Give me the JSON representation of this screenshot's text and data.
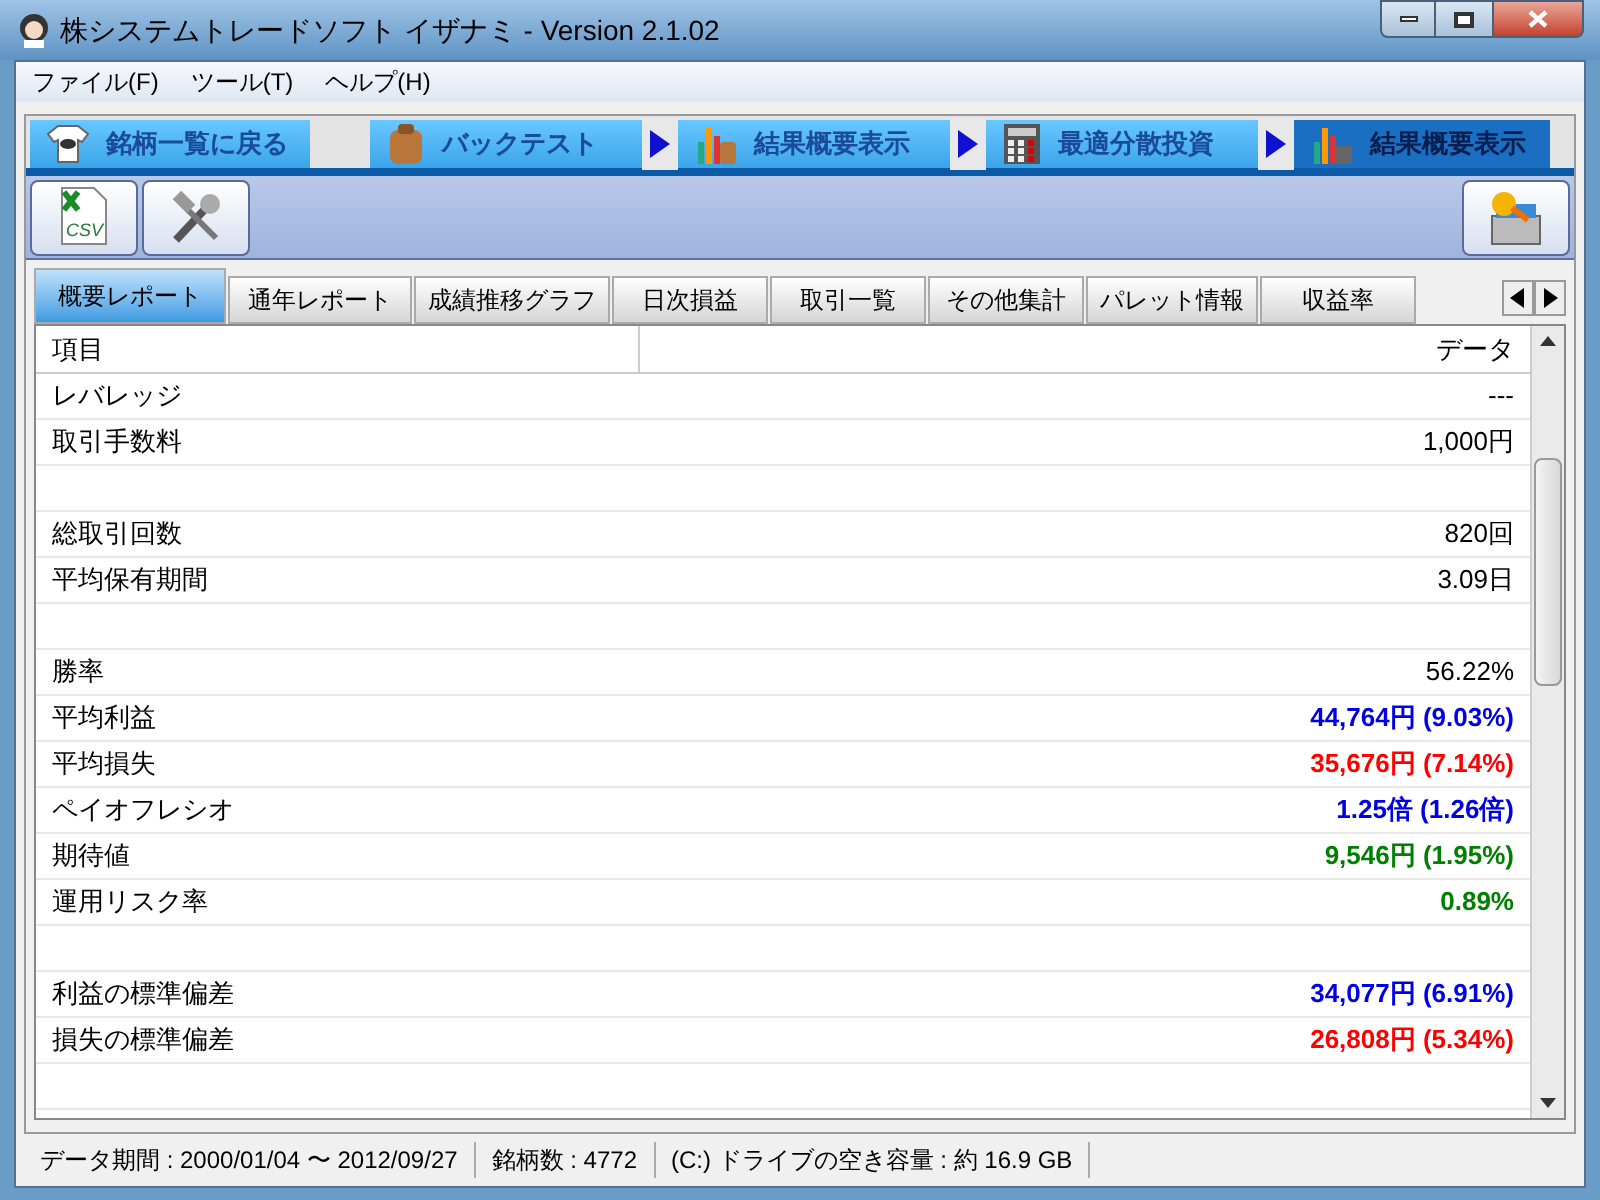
{
  "window": {
    "title": "株システムトレードソフト イザナミ - Version 2.1.02"
  },
  "menu": [
    "ファイル(F)",
    "ツール(T)",
    "ヘルプ(H)"
  ],
  "steps": [
    {
      "label": "銘柄一覧に戻る",
      "arrow_before": false,
      "selected": false
    },
    {
      "label": "バックテスト",
      "arrow_before": false,
      "selected": false
    },
    {
      "label": "結果概要表示",
      "arrow_before": true,
      "selected": false
    },
    {
      "label": "最適分散投資",
      "arrow_before": true,
      "selected": false
    },
    {
      "label": "結果概要表示",
      "arrow_before": true,
      "selected": true
    }
  ],
  "toolbar": {
    "csv_label": "CSV"
  },
  "tabs": [
    {
      "label": "概要レポート",
      "selected": true
    },
    {
      "label": "通年レポート",
      "selected": false
    },
    {
      "label": "成績推移グラフ",
      "selected": false
    },
    {
      "label": "日次損益",
      "selected": false
    },
    {
      "label": "取引一覧",
      "selected": false
    },
    {
      "label": "その他集計",
      "selected": false
    },
    {
      "label": "パレット情報",
      "selected": false
    },
    {
      "label": "収益率",
      "selected": false
    }
  ],
  "table": {
    "columns": [
      "項目",
      "データ"
    ],
    "rows": [
      {
        "kind": "row",
        "label": "レバレッジ",
        "value": "---",
        "color": "#000000",
        "bold": false
      },
      {
        "kind": "row",
        "label": "取引手数料",
        "value": "1,000円",
        "color": "#000000",
        "bold": false
      },
      {
        "kind": "blank"
      },
      {
        "kind": "row",
        "label": "総取引回数",
        "value": "820回",
        "color": "#000000",
        "bold": false
      },
      {
        "kind": "row",
        "label": "平均保有期間",
        "value": "3.09日",
        "color": "#000000",
        "bold": false
      },
      {
        "kind": "blank"
      },
      {
        "kind": "row",
        "label": "勝率",
        "value": "56.22%",
        "color": "#000000",
        "bold": false
      },
      {
        "kind": "row",
        "label": "平均利益",
        "value": "44,764円 (9.03%)",
        "color": "#0000e0",
        "bold": true
      },
      {
        "kind": "row",
        "label": "平均損失",
        "value": "35,676円 (7.14%)",
        "color": "#ff0000",
        "bold": true
      },
      {
        "kind": "row",
        "label": "ペイオフレシオ",
        "value": "1.25倍 (1.26倍)",
        "color": "#0000e0",
        "bold": true
      },
      {
        "kind": "row",
        "label": "期待値",
        "value": "9,546円 (1.95%)",
        "color": "#008000",
        "bold": true
      },
      {
        "kind": "row",
        "label": "運用リスク率",
        "value": "0.89%",
        "color": "#008000",
        "bold": true
      },
      {
        "kind": "blank"
      },
      {
        "kind": "row",
        "label": "利益の標準偏差",
        "value": "34,077円 (6.91%)",
        "color": "#0000e0",
        "bold": true
      },
      {
        "kind": "row",
        "label": "損失の標準偏差",
        "value": "26,808円 (5.34%)",
        "color": "#ff0000",
        "bold": true
      },
      {
        "kind": "blank"
      }
    ]
  },
  "status_bar": [
    "データ期間 : 2000/01/04 〜 2012/09/27",
    "銘柄数 : 4772",
    "(C:) ドライブの空き容量 : 約 16.9 GB"
  ]
}
